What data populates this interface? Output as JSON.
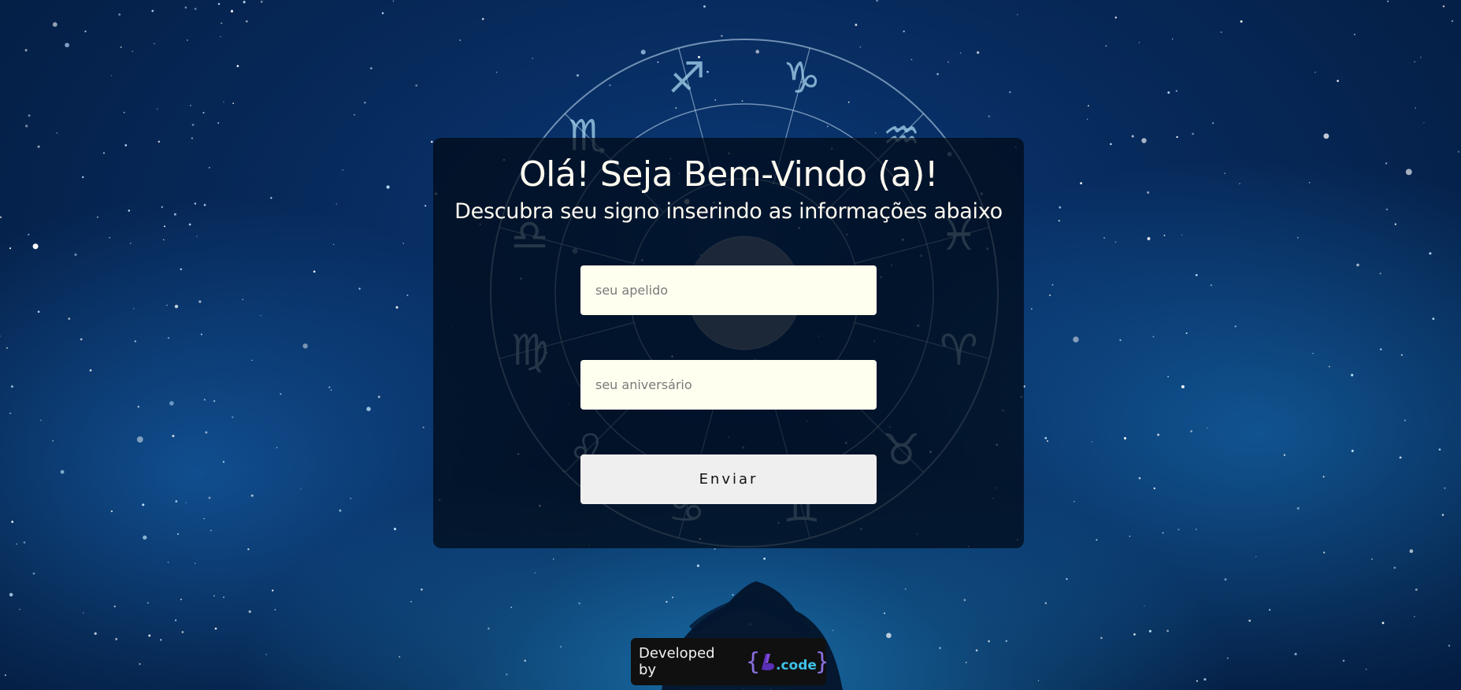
{
  "page": {
    "title": "Olá! Seja Bem-Vindo (a)!",
    "subtitle": "Descubra seu signo inserindo as informações abaixo"
  },
  "form": {
    "nickname_placeholder": "seu apelido",
    "nickname_value": "",
    "birthday_placeholder": "seu aniversário",
    "birthday_value": "",
    "submit_label": "Enviar"
  },
  "footer": {
    "developed_by": "Developed by",
    "logo_text": "b.code",
    "logo_icon": "bcode-logo-icon"
  },
  "background": {
    "icons": [
      "starfield-background",
      "zodiac-wheel-icon",
      "moon-icon",
      "tree-silhouette"
    ]
  },
  "colors": {
    "title_text": "#fffaf0",
    "input_bg": "#fffff0",
    "button_bg": "#efefef",
    "logo_purple": "#5a2fb8",
    "logo_cyan": "#3ec0e8"
  }
}
